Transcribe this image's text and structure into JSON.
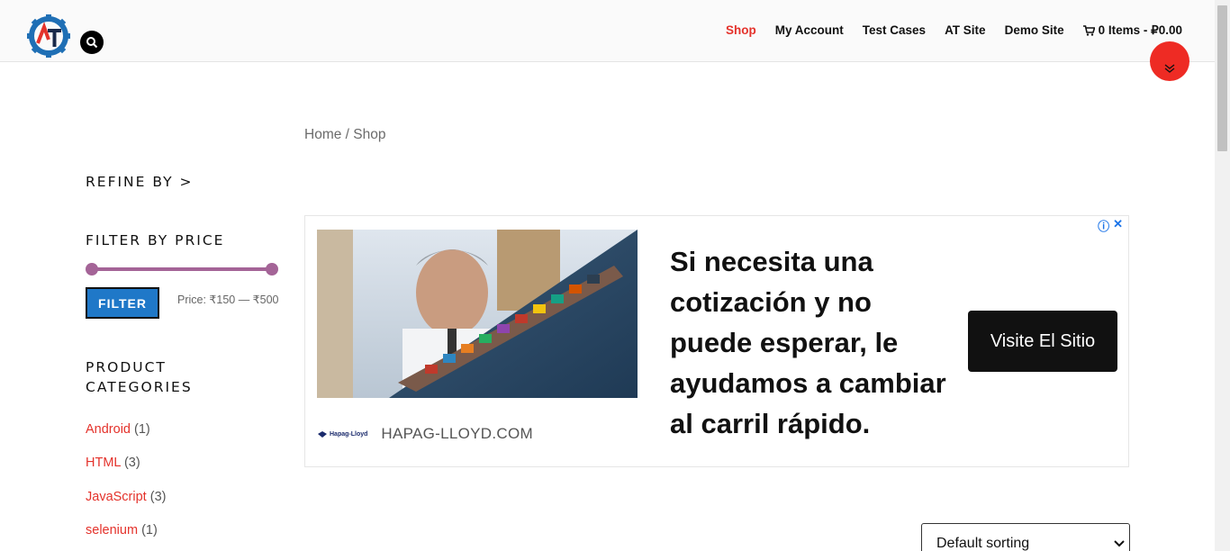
{
  "header": {
    "nav": [
      {
        "label": "Shop",
        "active": true
      },
      {
        "label": "My Account",
        "active": false
      },
      {
        "label": "Test Cases",
        "active": false
      },
      {
        "label": "AT Site",
        "active": false
      },
      {
        "label": "Demo Site",
        "active": false
      }
    ],
    "cart_label": "0 Items - ₽0.00"
  },
  "breadcrumb": {
    "home": "Home",
    "separator": " / ",
    "current": "Shop"
  },
  "sidebar": {
    "refine_title": "REFINE BY >",
    "filter_title": "FILTER BY PRICE",
    "filter_button": "FILTER",
    "price_label": "Price: ₹150 — ₹500",
    "categories_title_line1": "PRODUCT",
    "categories_title_line2": "CATEGORIES",
    "categories": [
      {
        "name": "Android",
        "count": "(1)"
      },
      {
        "name": "HTML",
        "count": "(3)"
      },
      {
        "name": "JavaScript",
        "count": "(3)"
      },
      {
        "name": "selenium",
        "count": "(1)"
      }
    ]
  },
  "ad": {
    "headline": "Si necesita una cotización y no puede esperar, le ayudamos a cambiar al carril rápido.",
    "cta": "Visite El Sitio",
    "domain": "HAPAG-LLOYD.COM",
    "brand": "Hapag-Lloyd"
  },
  "sorting": {
    "selected": "Default sorting"
  },
  "colors": {
    "accent": "#e4322b",
    "button": "#1f78c8",
    "slider": "#a46497"
  }
}
